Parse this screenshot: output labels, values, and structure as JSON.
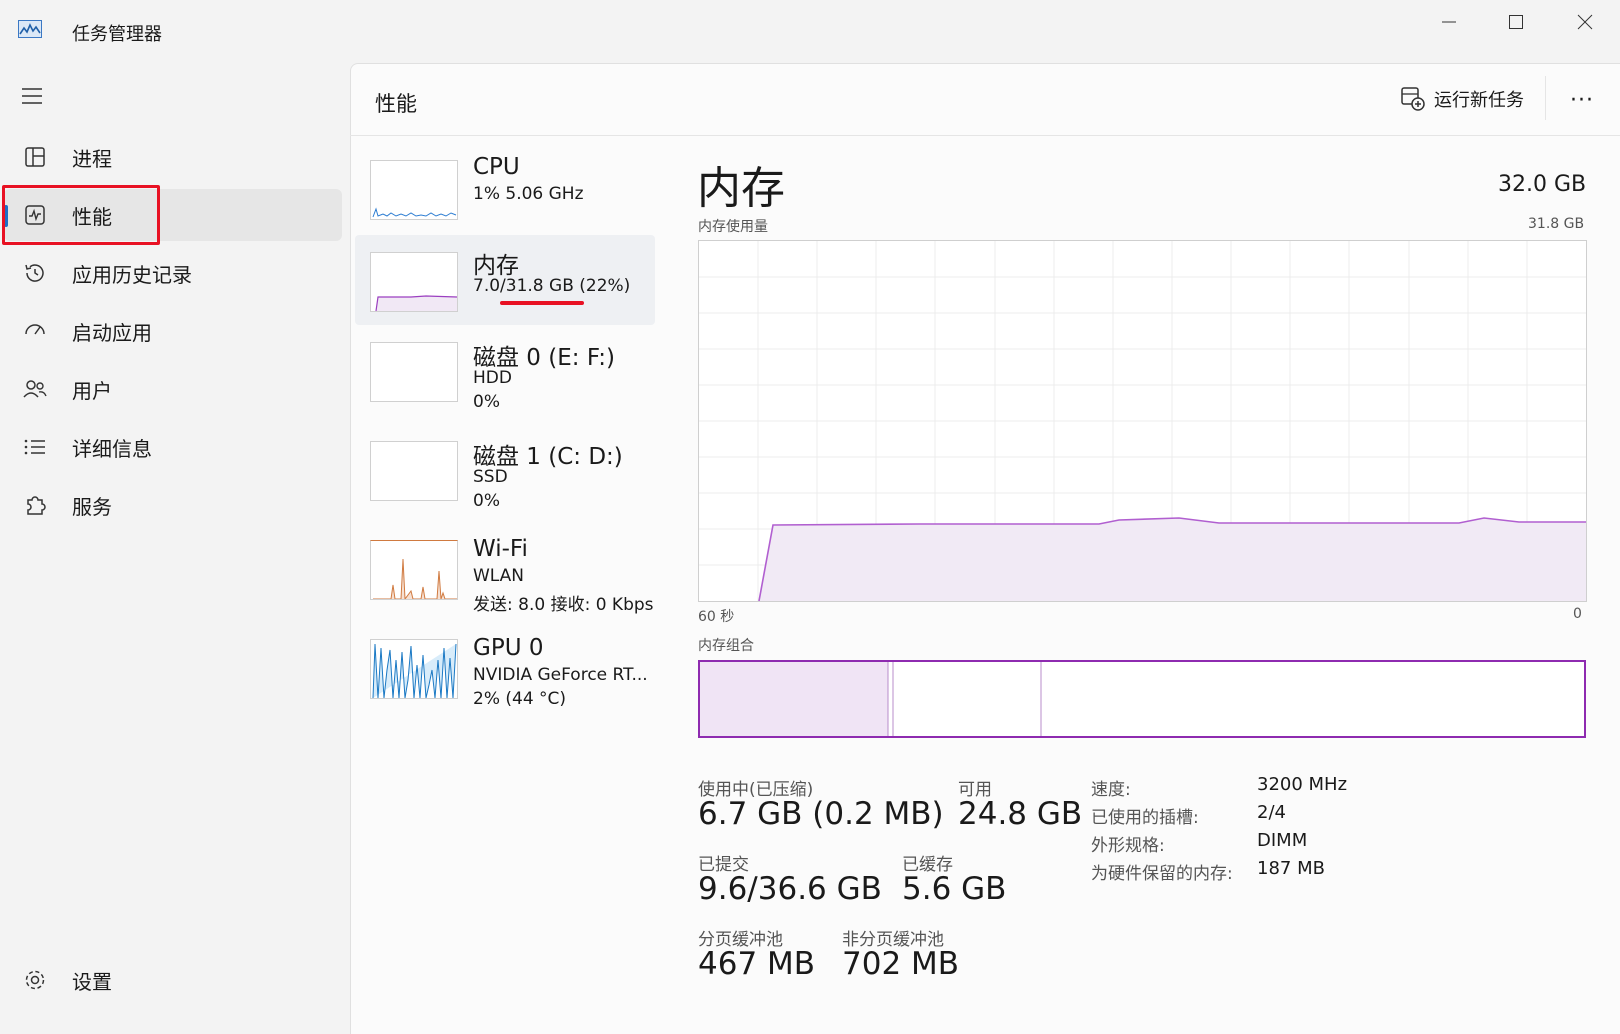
{
  "window": {
    "title": "任务管理器"
  },
  "sidebar": {
    "items": [
      {
        "label": "进程"
      },
      {
        "label": "性能"
      },
      {
        "label": "应用历史记录"
      },
      {
        "label": "启动应用"
      },
      {
        "label": "用户"
      },
      {
        "label": "详细信息"
      },
      {
        "label": "服务"
      }
    ],
    "settings": {
      "label": "设置"
    }
  },
  "header": {
    "title": "性能",
    "run_task": "运行新任务",
    "more": "···"
  },
  "resources": [
    {
      "name": "CPU",
      "line1": "1%  5.06 GHz",
      "line2": ""
    },
    {
      "name": "内存",
      "line1": "7.0/31.8 GB (22%)",
      "line2": ""
    },
    {
      "name": "磁盘 0 (E: F:)",
      "line1": "HDD",
      "line2": "0%"
    },
    {
      "name": "磁盘 1 (C: D:)",
      "line1": "SSD",
      "line2": "0%"
    },
    {
      "name": "Wi-Fi",
      "line1": "WLAN",
      "line2": "发送: 8.0 接收: 0 Kbps"
    },
    {
      "name": "GPU 0",
      "line1": "NVIDIA GeForce RT...",
      "line2": "2% (44 °C)"
    }
  ],
  "memory": {
    "title": "内存",
    "total": "32.0 GB",
    "usage_label": "内存使用量",
    "usage_max": "31.8 GB",
    "time_left": "60 秒",
    "time_right": "0",
    "composition_label": "内存组合",
    "in_use_label": "使用中(已压缩)",
    "in_use_value": "6.7 GB (0.2 MB)",
    "available_label": "可用",
    "available_value": "24.8 GB",
    "committed_label": "已提交",
    "committed_value": "9.6/36.6 GB",
    "cached_label": "已缓存",
    "cached_value": "5.6 GB",
    "paged_label": "分页缓冲池",
    "paged_value": "467 MB",
    "nonpaged_label": "非分页缓冲池",
    "nonpaged_value": "702 MB",
    "speed_label": "速度:",
    "speed_value": "3200 MHz",
    "slots_label": "已使用的插槽:",
    "slots_value": "2/4",
    "form_label": "外形规格:",
    "form_value": "DIMM",
    "reserved_label": "为硬件保留的内存:",
    "reserved_value": "187 MB"
  },
  "colors": {
    "accent": "#1f6fc5",
    "memory": "#9b3fc0",
    "highlight": "#e81123"
  }
}
